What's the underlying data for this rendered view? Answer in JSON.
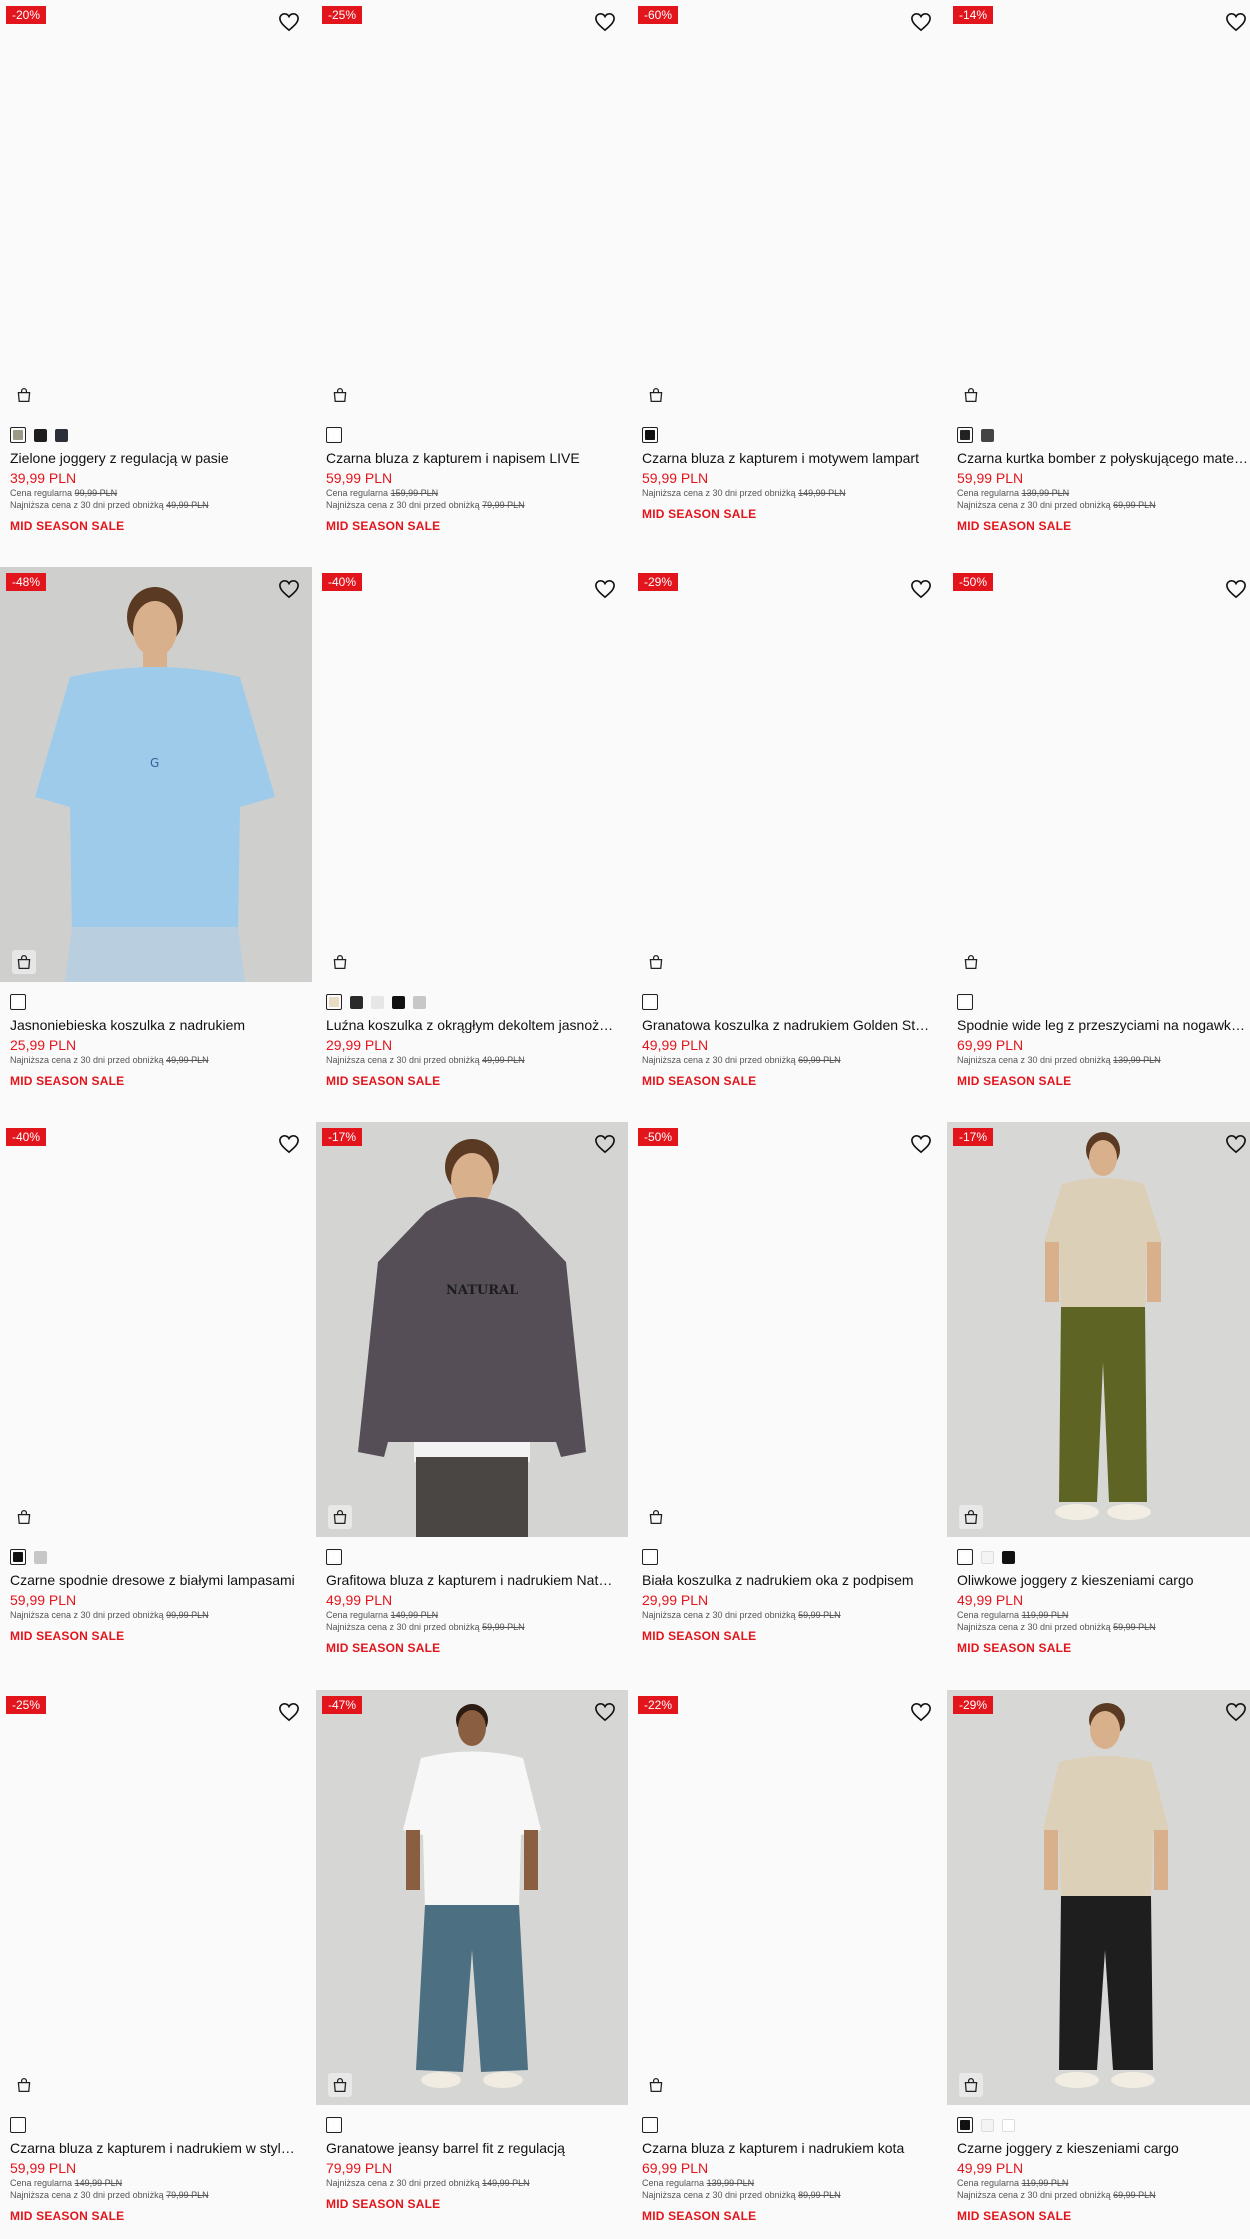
{
  "labels": {
    "regular": "Cena regularna",
    "lowest": "Najniższa cena z 30 dni przed obniżką"
  },
  "products": [
    {
      "discount": "-20%",
      "name": "Zielone joggery z regulacją w pasie",
      "price": "39,99 PLN",
      "regular": "99,99 PLN",
      "lowest": "49,99 PLN",
      "sale": "MID SEASON SALE",
      "swatches": [
        "#9a9a86",
        "#1e1e1e",
        "#2b2f38"
      ],
      "image": "none"
    },
    {
      "discount": "-25%",
      "name": "Czarna bluza z kapturem i napisem LIVE",
      "price": "59,99 PLN",
      "regular": "159,99 PLN",
      "lowest": "79,99 PLN",
      "sale": "MID SEASON SALE",
      "swatches": [
        "#ffffff"
      ],
      "image": "none"
    },
    {
      "discount": "-60%",
      "name": "Czarna bluza z kapturem i motywem lampart",
      "price": "59,99 PLN",
      "regular": "",
      "lowest": "149,99 PLN",
      "sale": "MID SEASON SALE",
      "swatches": [
        "#111111"
      ],
      "image": "none"
    },
    {
      "discount": "-14%",
      "name": "Czarna kurtka bomber z połyskującego materiału",
      "price": "59,99 PLN",
      "regular": "139,99 PLN",
      "lowest": "69,99 PLN",
      "sale": "MID SEASON SALE",
      "swatches": [
        "#222222",
        "#444444"
      ],
      "image": "none"
    },
    {
      "discount": "-48%",
      "name": "Jasnoniebieska koszulka z nadrukiem",
      "price": "25,99 PLN",
      "regular": "",
      "lowest": "49,99 PLN",
      "sale": "MID SEASON SALE",
      "swatches": [
        "#ffffff"
      ],
      "image": "blue-tee"
    },
    {
      "discount": "-40%",
      "name": "Luźna koszulka z okrągłym dekoltem jasnożółta",
      "price": "29,99 PLN",
      "regular": "",
      "lowest": "49,99 PLN",
      "sale": "MID SEASON SALE",
      "swatches": [
        "#e8dcc4",
        "#2a2a2a",
        "#e6e6e6",
        "#111111",
        "#c7c7c7"
      ],
      "image": "none"
    },
    {
      "discount": "-29%",
      "name": "Granatowa koszulka z nadrukiem Golden State",
      "price": "49,99 PLN",
      "regular": "",
      "lowest": "69,99 PLN",
      "sale": "MID SEASON SALE",
      "swatches": [
        "#ffffff"
      ],
      "image": "none"
    },
    {
      "discount": "-50%",
      "name": "Spodnie wide leg z przeszyciami na nogawkach",
      "price": "69,99 PLN",
      "regular": "",
      "lowest": "139,99 PLN",
      "sale": "MID SEASON SALE",
      "swatches": [
        "#ffffff"
      ],
      "image": "none"
    },
    {
      "discount": "-40%",
      "name": "Czarne spodnie dresowe z białymi lampasami",
      "price": "59,99 PLN",
      "regular": "",
      "lowest": "99,99 PLN",
      "sale": "MID SEASON SALE",
      "swatches": [
        "#111111",
        "#c7c7c7"
      ],
      "image": "none"
    },
    {
      "discount": "-17%",
      "name": "Grafitowa bluza z kapturem i nadrukiem Natural",
      "price": "49,99 PLN",
      "regular": "149,99 PLN",
      "lowest": "59,99 PLN",
      "sale": "MID SEASON SALE",
      "swatches": [
        "#ffffff"
      ],
      "image": "hoodie"
    },
    {
      "discount": "-50%",
      "name": "Biała koszulka z nadrukiem oka z podpisem",
      "price": "29,99 PLN",
      "regular": "",
      "lowest": "59,99 PLN",
      "sale": "MID SEASON SALE",
      "swatches": [
        "#ffffff"
      ],
      "image": "none"
    },
    {
      "discount": "-17%",
      "name": "Oliwkowe joggery z kieszeniami cargo",
      "price": "49,99 PLN",
      "regular": "119,99 PLN",
      "lowest": "59,99 PLN",
      "sale": "MID SEASON SALE",
      "swatches": [
        "#ffffff",
        "#f4f4f4",
        "#111111"
      ],
      "image": "olive-cargo"
    },
    {
      "discount": "-25%",
      "name": "Czarna bluza z kapturem i nadrukiem w stylu college",
      "price": "59,99 PLN",
      "regular": "149,99 PLN",
      "lowest": "79,99 PLN",
      "sale": "MID SEASON SALE",
      "swatches": [
        "#ffffff"
      ],
      "image": "none"
    },
    {
      "discount": "-47%",
      "name": "Granatowe jeansy barrel fit z regulacją",
      "price": "79,99 PLN",
      "regular": "",
      "lowest": "149,99 PLN",
      "sale": "MID SEASON SALE",
      "swatches": [
        "#ffffff"
      ],
      "image": "jeans"
    },
    {
      "discount": "-22%",
      "name": "Czarna bluza z kapturem i nadrukiem kota",
      "price": "69,99 PLN",
      "regular": "139,99 PLN",
      "lowest": "89,99 PLN",
      "sale": "MID SEASON SALE",
      "swatches": [
        "#ffffff"
      ],
      "image": "none"
    },
    {
      "discount": "-29%",
      "name": "Czarne joggery z kieszeniami cargo",
      "price": "49,99 PLN",
      "regular": "119,99 PLN",
      "lowest": "69,99 PLN",
      "sale": "MID SEASON SALE",
      "swatches": [
        "#111111",
        "#f4f4f4",
        "#ffffff"
      ],
      "image": "black-cargo"
    }
  ]
}
